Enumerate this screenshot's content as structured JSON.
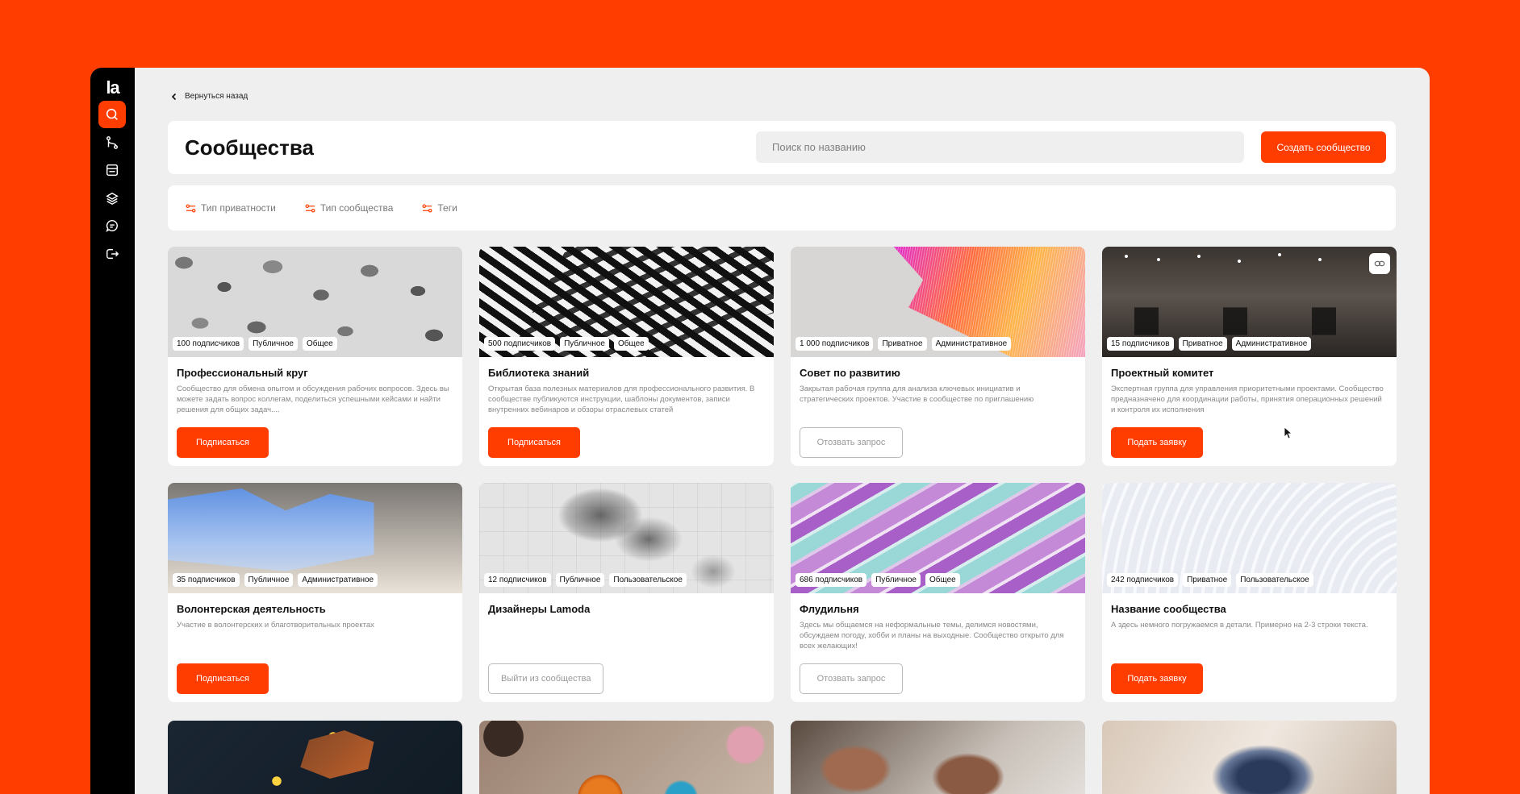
{
  "app": {
    "logo": "la",
    "back_label": "Вернуться назад",
    "page_title": "Сообщества",
    "search_placeholder": "Поиск по названию",
    "create_label": "Создать сообщество",
    "accent": "#FF3D00"
  },
  "nav": [
    {
      "icon": "search-icon",
      "active": true
    },
    {
      "icon": "branch-icon",
      "active": false
    },
    {
      "icon": "calendar-icon",
      "active": false
    },
    {
      "icon": "layers-icon",
      "active": false
    },
    {
      "icon": "chat-icon",
      "active": false
    },
    {
      "icon": "logout-icon",
      "active": false
    }
  ],
  "filters": [
    {
      "label": "Тип приватности",
      "icon": "filter-icon"
    },
    {
      "label": "Тип сообщества",
      "icon": "filter-icon"
    },
    {
      "label": "Теги",
      "icon": "filter-icon"
    }
  ],
  "cards": [
    {
      "title": "Профессиональный круг",
      "desc": "Сообщество для обмена опытом и обсуждения рабочих вопросов. Здесь вы можете задать вопрос коллегам, поделиться успешными кейсами и найти решения для общих задач....",
      "tags": [
        "100 подписчиков",
        "Публичное",
        "Общее"
      ],
      "button": "Подписаться",
      "button_style": "primary"
    },
    {
      "title": "Библиотека знаний",
      "desc": "Открытая база полезных материалов для профессионального развития. В сообществе публикуются инструкции, шаблоны документов, записи внутренних вебинаров и обзоры отраслевых статей",
      "tags": [
        "500 подписчиков",
        "Публичное",
        "Общее"
      ],
      "button": "Подписаться",
      "button_style": "primary"
    },
    {
      "title": "Совет по развитию",
      "desc": "Закрытая рабочая группа для анализа ключевых инициатив и стратегических проектов. Участие в сообществе по приглашению",
      "tags": [
        "1 000 подписчиков",
        "Приватное",
        "Административное"
      ],
      "button": "Отозвать запрос",
      "button_style": "outline"
    },
    {
      "title": "Проектный комитет",
      "desc": "Экспертная группа для управления приоритетными проектами. Сообщество предназначено для координации работы, принятия операционных решений и контроля их исполнения",
      "tags": [
        "15 подписчиков",
        "Приватное",
        "Административное"
      ],
      "button": "Подать заявку",
      "button_style": "primary"
    },
    {
      "title": "Волонтерская деятельность",
      "desc": "Участие в волонтерских и благотворительных проектах",
      "tags": [
        "35 подписчиков",
        "Публичное",
        "Административное"
      ],
      "button": "Подписаться",
      "button_style": "primary"
    },
    {
      "title": "Дизайнеры Lamoda",
      "desc": "",
      "tags": [
        "12 подписчиков",
        "Публичное",
        "Пользовательское"
      ],
      "button": "Выйти из сообщества",
      "button_style": "outline"
    },
    {
      "title": "Флудильня",
      "desc": "Здесь мы общаемся на неформальные темы, делимся новостями, обсуждаем погоду, хобби и планы на выходные. Сообщество открыто для всех желающих!",
      "tags": [
        "686 подписчиков",
        "Публичное",
        "Общее"
      ],
      "button": "Отозвать запрос",
      "button_style": "outline"
    },
    {
      "title": "Название сообщества",
      "desc": "А здесь немного погружаемся в детали. Примерно на 2-3 строки текста.",
      "tags": [
        "242 подписчиков",
        "Приватное",
        "Пользовательское"
      ],
      "button": "Подать заявку",
      "button_style": "primary"
    }
  ]
}
